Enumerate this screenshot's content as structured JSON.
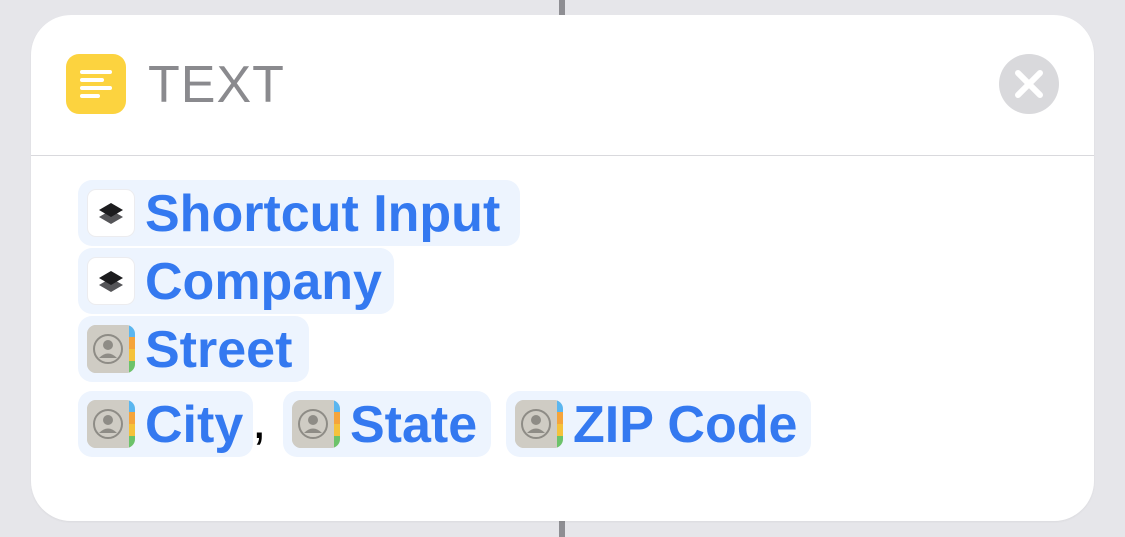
{
  "action": {
    "title": "TEXT",
    "icon": "text-lines-icon",
    "accent_color": "#fcd33f",
    "close_icon": "close-x-icon"
  },
  "text_body": {
    "lines": [
      [
        {
          "kind": "shortcut",
          "icon": "shortcuts-layers-icon",
          "label": "Shortcut Input"
        }
      ],
      [
        {
          "kind": "shortcut",
          "icon": "shortcuts-layers-icon",
          "label": "Company"
        }
      ],
      [
        {
          "kind": "contact",
          "icon": "contacts-icon",
          "label": "Street"
        }
      ],
      [
        {
          "kind": "contact",
          "icon": "contacts-icon",
          "label": "City"
        },
        {
          "kind": "contact",
          "icon": "contacts-icon",
          "label": "State"
        },
        {
          "kind": "contact",
          "icon": "contacts-icon",
          "label": "ZIP Code"
        }
      ]
    ],
    "separator": ",",
    "token_color": "#3479f0",
    "token_background": "#edf4fe"
  }
}
